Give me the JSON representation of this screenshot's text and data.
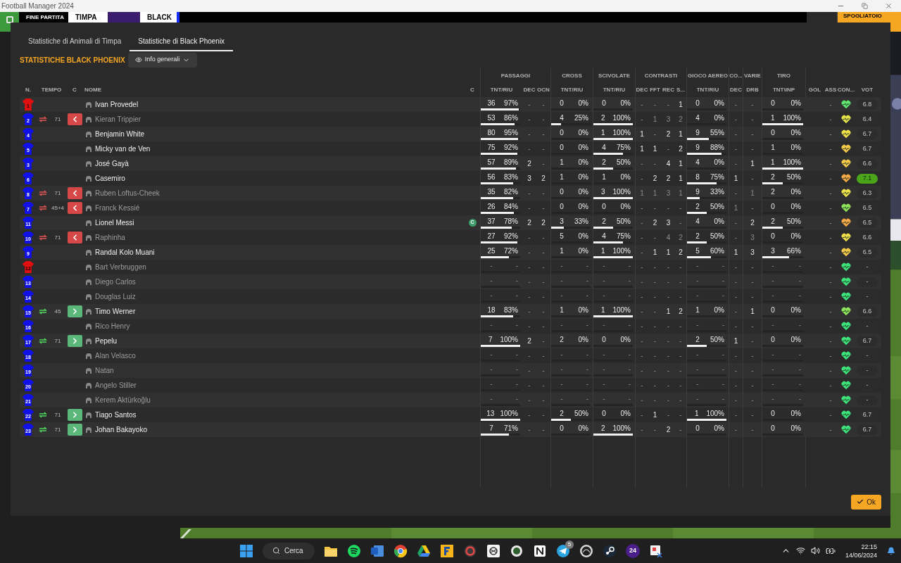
{
  "window": {
    "title": "Football Manager 2024"
  },
  "match_bar": {
    "status": "FINE PARTITA",
    "home": "TIMPA",
    "away": "BLACK",
    "button": "SPOGLIATOIO"
  },
  "tabs": [
    {
      "label": "Statistiche di Animali di Timpa",
      "selected": false
    },
    {
      "label": "Statistiche di Black Phoenix",
      "selected": true
    }
  ],
  "heading": "STATISTICHE BLACK PHOENIX",
  "view_dropdown": {
    "label": "Info generali"
  },
  "table": {
    "groups": [
      "PASSAGGI",
      "CROSS",
      "SCIVOLATE",
      "CONTRASTI",
      "GIOCO AEREO",
      "CO...",
      "VARIE",
      "TIRO"
    ],
    "columns": [
      "N.",
      "TEMPO",
      "C",
      "NOME",
      "C",
      "TNT/RIU",
      "DEC",
      "OCN",
      "TNT/RIU",
      "TNT/RIU",
      "DEC",
      "FFT",
      "REC",
      "S...",
      "TNT/RIU",
      "DEC",
      "DRB",
      "TNT\\INP",
      "GOL",
      "ASS",
      "CON...",
      "VOT"
    ],
    "captain_label": "C",
    "rows": [
      {
        "number": "1",
        "color": "#e01010",
        "name": "Ivan Provedel",
        "dimmed": false,
        "captain": false,
        "condition": {
          "color": "#5ee36e"
        },
        "rating": "6.8",
        "best": false,
        "stats": [
          {
            "count": "36",
            "pct": "97%",
            "level": 0.97
          },
          "-",
          "-",
          {
            "count": "0",
            "pct": "0%"
          },
          {
            "count": "0",
            "pct": "0%"
          },
          "-",
          "-",
          "-",
          "1",
          {
            "count": "0",
            "pct": "0%"
          },
          "-",
          "-",
          {
            "count": "0",
            "pct": "0%"
          },
          "-"
        ]
      },
      {
        "number": "2",
        "color": "#1010e8",
        "name": "Kieran Trippier",
        "dimmed": true,
        "captain": false,
        "sub": {
          "kind": "off",
          "minute": "71"
        },
        "condition": {
          "color": "#e3e04a"
        },
        "rating": "6.4",
        "best": false,
        "stats": [
          {
            "count": "53",
            "pct": "86%",
            "level": 0.86
          },
          "-",
          "-",
          {
            "count": "4",
            "pct": "25%",
            "level": 0.25
          },
          {
            "count": "2",
            "pct": "100%",
            "level": 1
          },
          "-",
          "1",
          "3",
          "2",
          {
            "count": "4",
            "pct": "0%"
          },
          "-",
          "-",
          {
            "count": "1",
            "pct": "100%",
            "level": 1
          },
          "-"
        ]
      },
      {
        "number": "4",
        "color": "#1010e8",
        "name": "Benjamin White",
        "dimmed": false,
        "captain": false,
        "condition": {
          "color": "#f2e24a"
        },
        "rating": "6.7",
        "best": false,
        "stats": [
          {
            "count": "80",
            "pct": "95%",
            "level": 0.95
          },
          "-",
          "-",
          {
            "count": "0",
            "pct": "0%"
          },
          {
            "count": "1",
            "pct": "100%",
            "level": 1
          },
          "1",
          "-",
          "2",
          "1",
          {
            "count": "9",
            "pct": "55%",
            "level": 0.55
          },
          "-",
          "-",
          {
            "count": "0",
            "pct": "0%"
          },
          "-"
        ]
      },
      {
        "number": "5",
        "color": "#1010e8",
        "name": "Micky van de Ven",
        "dimmed": false,
        "captain": false,
        "condition": {
          "color": "#f5c84a"
        },
        "rating": "6.7",
        "best": false,
        "stats": [
          {
            "count": "75",
            "pct": "92%",
            "level": 0.92
          },
          "-",
          "-",
          {
            "count": "0",
            "pct": "0%"
          },
          {
            "count": "4",
            "pct": "75%",
            "level": 0.75
          },
          "1",
          "1",
          "-",
          "2",
          {
            "count": "9",
            "pct": "88%",
            "level": 0.88
          },
          "-",
          "-",
          {
            "count": "1",
            "pct": "0%"
          },
          "-"
        ]
      },
      {
        "number": "3",
        "color": "#1010e8",
        "name": "José Gayà",
        "dimmed": false,
        "captain": false,
        "condition": {
          "color": "#f5c84a"
        },
        "rating": "6.6",
        "best": false,
        "stats": [
          {
            "count": "57",
            "pct": "89%",
            "level": 0.89
          },
          "2",
          "-",
          {
            "count": "1",
            "pct": "0%"
          },
          {
            "count": "2",
            "pct": "50%",
            "level": 0.5
          },
          "-",
          "-",
          "4",
          "1",
          {
            "count": "4",
            "pct": "0%"
          },
          "-",
          "1",
          {
            "count": "1",
            "pct": "100%",
            "level": 1
          },
          "-"
        ]
      },
      {
        "number": "6",
        "color": "#1010e8",
        "name": "Casemiro",
        "dimmed": false,
        "captain": false,
        "condition": {
          "color": "#f5a845"
        },
        "rating": "7.1",
        "best": true,
        "stats": [
          {
            "count": "56",
            "pct": "83%",
            "level": 0.83
          },
          "3",
          "2",
          {
            "count": "1",
            "pct": "0%"
          },
          {
            "count": "1",
            "pct": "0%"
          },
          "-",
          "2",
          "2",
          "1",
          {
            "count": "8",
            "pct": "75%",
            "level": 0.75
          },
          "1",
          "-",
          {
            "count": "2",
            "pct": "50%",
            "level": 0.5
          },
          "-"
        ]
      },
      {
        "number": "8",
        "color": "#1010e8",
        "name": "Ruben Loftus-Cheek",
        "dimmed": true,
        "captain": false,
        "sub": {
          "kind": "off",
          "minute": "71"
        },
        "condition": {
          "color": "#f0e04a"
        },
        "rating": "6.3",
        "best": false,
        "stats": [
          {
            "count": "35",
            "pct": "82%",
            "level": 0.82
          },
          "-",
          "-",
          {
            "count": "0",
            "pct": "0%"
          },
          {
            "count": "3",
            "pct": "100%",
            "level": 1
          },
          "1",
          "1",
          "3",
          "1",
          {
            "count": "9",
            "pct": "33%",
            "level": 0.33
          },
          "-",
          "1",
          {
            "count": "2",
            "pct": "0%"
          },
          "-"
        ]
      },
      {
        "number": "7",
        "color": "#1010e8",
        "name": "Franck Kessié",
        "dimmed": true,
        "captain": false,
        "sub": {
          "kind": "off",
          "minute": "45+4"
        },
        "condition": {
          "color": "#8ee35a"
        },
        "rating": "6.5",
        "best": false,
        "stats": [
          {
            "count": "26",
            "pct": "84%",
            "level": 0.84
          },
          "-",
          "-",
          {
            "count": "0",
            "pct": "0%"
          },
          {
            "count": "0",
            "pct": "0%"
          },
          "-",
          "-",
          "-",
          "-",
          {
            "count": "2",
            "pct": "50%",
            "level": 0.5
          },
          "1",
          "-",
          {
            "count": "0",
            "pct": "0%"
          },
          "-"
        ]
      },
      {
        "number": "11",
        "color": "#1010e8",
        "name": "Lionel Messi",
        "dimmed": false,
        "captain": true,
        "condition": {
          "color": "#f5a845"
        },
        "rating": "6.5",
        "best": false,
        "stats": [
          {
            "count": "37",
            "pct": "78%",
            "level": 0.78
          },
          "2",
          "2",
          {
            "count": "3",
            "pct": "33%",
            "level": 0.33
          },
          {
            "count": "2",
            "pct": "50%",
            "level": 0.5
          },
          "-",
          "2",
          "3",
          "-",
          {
            "count": "4",
            "pct": "0%"
          },
          "-",
          "2",
          {
            "count": "2",
            "pct": "50%",
            "level": 0.5
          },
          "-"
        ]
      },
      {
        "number": "10",
        "color": "#1010e8",
        "name": "Raphinha",
        "dimmed": true,
        "captain": false,
        "sub": {
          "kind": "off",
          "minute": "71"
        },
        "condition": {
          "color": "#f0dc4a"
        },
        "rating": "6.6",
        "best": false,
        "stats": [
          {
            "count": "27",
            "pct": "92%",
            "level": 0.92
          },
          "-",
          "-",
          {
            "count": "5",
            "pct": "0%"
          },
          {
            "count": "4",
            "pct": "75%",
            "level": 0.75
          },
          "-",
          "-",
          "4",
          "2",
          {
            "count": "2",
            "pct": "50%",
            "level": 0.5
          },
          "-",
          "3",
          {
            "count": "0",
            "pct": "0%"
          },
          "-"
        ]
      },
      {
        "number": "9",
        "color": "#1010e8",
        "name": "Randal Kolo Muani",
        "dimmed": false,
        "captain": false,
        "condition": {
          "color": "#f5c84a"
        },
        "rating": "6.5",
        "best": false,
        "stats": [
          {
            "count": "25",
            "pct": "72%",
            "level": 0.72
          },
          "-",
          "-",
          {
            "count": "1",
            "pct": "0%"
          },
          {
            "count": "1",
            "pct": "100%",
            "level": 1
          },
          "-",
          "1",
          "1",
          "2",
          {
            "count": "5",
            "pct": "60%",
            "level": 0.6
          },
          "1",
          "3",
          {
            "count": "3",
            "pct": "66%",
            "level": 0.66
          },
          "-"
        ]
      },
      {
        "number": "12",
        "color": "#e01010",
        "name": "Bart Verbruggen",
        "dimmed": true,
        "captain": false,
        "condition": {
          "color": "#3de27a"
        },
        "rating": "-",
        "best": false,
        "stats": [
          {
            "count": "-",
            "pct": "-"
          },
          "-",
          "-",
          {
            "count": "-",
            "pct": "-"
          },
          {
            "count": "-",
            "pct": "-"
          },
          "-",
          "-",
          "-",
          "-",
          {
            "count": "-",
            "pct": "-"
          },
          "-",
          "-",
          {
            "count": "-",
            "pct": "-"
          },
          "-"
        ]
      },
      {
        "number": "13",
        "color": "#1010e8",
        "name": "Diego Carlos",
        "dimmed": true,
        "captain": false,
        "condition": {
          "color": "#3de27a"
        },
        "rating": "-",
        "best": false,
        "stats": [
          {
            "count": "-",
            "pct": "-"
          },
          "-",
          "-",
          {
            "count": "-",
            "pct": "-"
          },
          {
            "count": "-",
            "pct": "-"
          },
          "-",
          "-",
          "-",
          "-",
          {
            "count": "-",
            "pct": "-"
          },
          "-",
          "-",
          {
            "count": "-",
            "pct": "-"
          },
          "-"
        ]
      },
      {
        "number": "14",
        "color": "#1010e8",
        "name": "Douglas Luiz",
        "dimmed": true,
        "captain": false,
        "condition": {
          "color": "#3de27a"
        },
        "rating": "-",
        "best": false,
        "stats": [
          {
            "count": "-",
            "pct": "-"
          },
          "-",
          "-",
          {
            "count": "-",
            "pct": "-"
          },
          {
            "count": "-",
            "pct": "-"
          },
          "-",
          "-",
          "-",
          "-",
          {
            "count": "-",
            "pct": "-"
          },
          "-",
          "-",
          {
            "count": "-",
            "pct": "-"
          },
          "-"
        ]
      },
      {
        "number": "15",
        "color": "#1010e8",
        "name": "Timo Werner",
        "dimmed": false,
        "captain": false,
        "sub": {
          "kind": "on",
          "minute": "45"
        },
        "condition": {
          "color": "#8ee35a"
        },
        "rating": "6.6",
        "best": false,
        "stats": [
          {
            "count": "18",
            "pct": "83%",
            "level": 0.83
          },
          "-",
          "-",
          {
            "count": "1",
            "pct": "0%"
          },
          {
            "count": "1",
            "pct": "100%",
            "level": 1
          },
          "-",
          "-",
          "1",
          "2",
          {
            "count": "1",
            "pct": "0%"
          },
          "-",
          "1",
          {
            "count": "0",
            "pct": "0%"
          },
          "-"
        ]
      },
      {
        "number": "16",
        "color": "#1010e8",
        "name": "Rico Henry",
        "dimmed": true,
        "captain": false,
        "condition": {
          "color": "#3de27a"
        },
        "rating": "-",
        "best": false,
        "stats": [
          {
            "count": "-",
            "pct": "-"
          },
          "-",
          "-",
          {
            "count": "-",
            "pct": "-"
          },
          {
            "count": "-",
            "pct": "-"
          },
          "-",
          "-",
          "-",
          "-",
          {
            "count": "-",
            "pct": "-"
          },
          "-",
          "-",
          {
            "count": "-",
            "pct": "-"
          },
          "-"
        ]
      },
      {
        "number": "17",
        "color": "#1010e8",
        "name": "Pepelu",
        "dimmed": false,
        "captain": false,
        "sub": {
          "kind": "on",
          "minute": "71"
        },
        "condition": {
          "color": "#3de27a"
        },
        "rating": "6.7",
        "best": false,
        "stats": [
          {
            "count": "7",
            "pct": "100%",
            "level": 1
          },
          "2",
          "-",
          {
            "count": "2",
            "pct": "0%"
          },
          {
            "count": "0",
            "pct": "0%"
          },
          "-",
          "-",
          "-",
          "-",
          {
            "count": "2",
            "pct": "50%",
            "level": 0.5
          },
          "1",
          "-",
          {
            "count": "0",
            "pct": "0%"
          },
          "-"
        ]
      },
      {
        "number": "18",
        "color": "#1010e8",
        "name": "Alan Velasco",
        "dimmed": true,
        "captain": false,
        "condition": {
          "color": "#3de27a"
        },
        "rating": "-",
        "best": false,
        "stats": [
          {
            "count": "-",
            "pct": "-"
          },
          "-",
          "-",
          {
            "count": "-",
            "pct": "-"
          },
          {
            "count": "-",
            "pct": "-"
          },
          "-",
          "-",
          "-",
          "-",
          {
            "count": "-",
            "pct": "-"
          },
          "-",
          "-",
          {
            "count": "-",
            "pct": "-"
          },
          "-"
        ]
      },
      {
        "number": "19",
        "color": "#1010e8",
        "name": "Natan",
        "dimmed": true,
        "captain": false,
        "condition": {
          "color": "#3de27a"
        },
        "rating": "-",
        "best": false,
        "stats": [
          {
            "count": "-",
            "pct": "-"
          },
          "-",
          "-",
          {
            "count": "-",
            "pct": "-"
          },
          {
            "count": "-",
            "pct": "-"
          },
          "-",
          "-",
          "-",
          "-",
          {
            "count": "-",
            "pct": "-"
          },
          "-",
          "-",
          {
            "count": "-",
            "pct": "-"
          },
          "-"
        ]
      },
      {
        "number": "20",
        "color": "#1010e8",
        "name": "Angelo Stiller",
        "dimmed": true,
        "captain": false,
        "condition": {
          "color": "#3de27a"
        },
        "rating": "-",
        "best": false,
        "stats": [
          {
            "count": "-",
            "pct": "-"
          },
          "-",
          "-",
          {
            "count": "-",
            "pct": "-"
          },
          {
            "count": "-",
            "pct": "-"
          },
          "-",
          "-",
          "-",
          "-",
          {
            "count": "-",
            "pct": "-"
          },
          "-",
          "-",
          {
            "count": "-",
            "pct": "-"
          },
          "-"
        ]
      },
      {
        "number": "21",
        "color": "#1010e8",
        "name": "Kerem Aktürkoğlu",
        "dimmed": true,
        "captain": false,
        "condition": {
          "color": "#3de27a"
        },
        "rating": "-",
        "best": false,
        "stats": [
          {
            "count": "-",
            "pct": "-"
          },
          "-",
          "-",
          {
            "count": "-",
            "pct": "-"
          },
          {
            "count": "-",
            "pct": "-"
          },
          "-",
          "-",
          "-",
          "-",
          {
            "count": "-",
            "pct": "-"
          },
          "-",
          "-",
          {
            "count": "-",
            "pct": "-"
          },
          "-"
        ]
      },
      {
        "number": "22",
        "color": "#1010e8",
        "name": "Tiago Santos",
        "dimmed": false,
        "captain": false,
        "sub": {
          "kind": "on",
          "minute": "71"
        },
        "condition": {
          "color": "#3de27a"
        },
        "rating": "6.7",
        "best": false,
        "stats": [
          {
            "count": "13",
            "pct": "100%",
            "level": 1
          },
          "-",
          "-",
          {
            "count": "2",
            "pct": "50%",
            "level": 0.5
          },
          {
            "count": "0",
            "pct": "0%"
          },
          "-",
          "1",
          "-",
          "-",
          {
            "count": "1",
            "pct": "100%",
            "level": 1
          },
          "-",
          "-",
          {
            "count": "0",
            "pct": "0%"
          },
          "-"
        ]
      },
      {
        "number": "23",
        "color": "#1010e8",
        "name": "Johan Bakayoko",
        "dimmed": false,
        "captain": false,
        "sub": {
          "kind": "on",
          "minute": "71"
        },
        "condition": {
          "color": "#3de27a"
        },
        "rating": "6.7",
        "best": false,
        "stats": [
          {
            "count": "7",
            "pct": "71%",
            "level": 0.71
          },
          "-",
          "-",
          {
            "count": "0",
            "pct": "0%"
          },
          {
            "count": "2",
            "pct": "100%",
            "level": 1
          },
          "-",
          "-",
          "2",
          "-",
          {
            "count": "0",
            "pct": "0%"
          },
          "-",
          "-",
          {
            "count": "0",
            "pct": "0%"
          },
          "-"
        ]
      }
    ]
  },
  "ok_button": "Ok",
  "taskbar": {
    "search": "Cerca",
    "badge": "5",
    "game_label": "24",
    "time": "22:15",
    "date": "14/06/2024"
  }
}
